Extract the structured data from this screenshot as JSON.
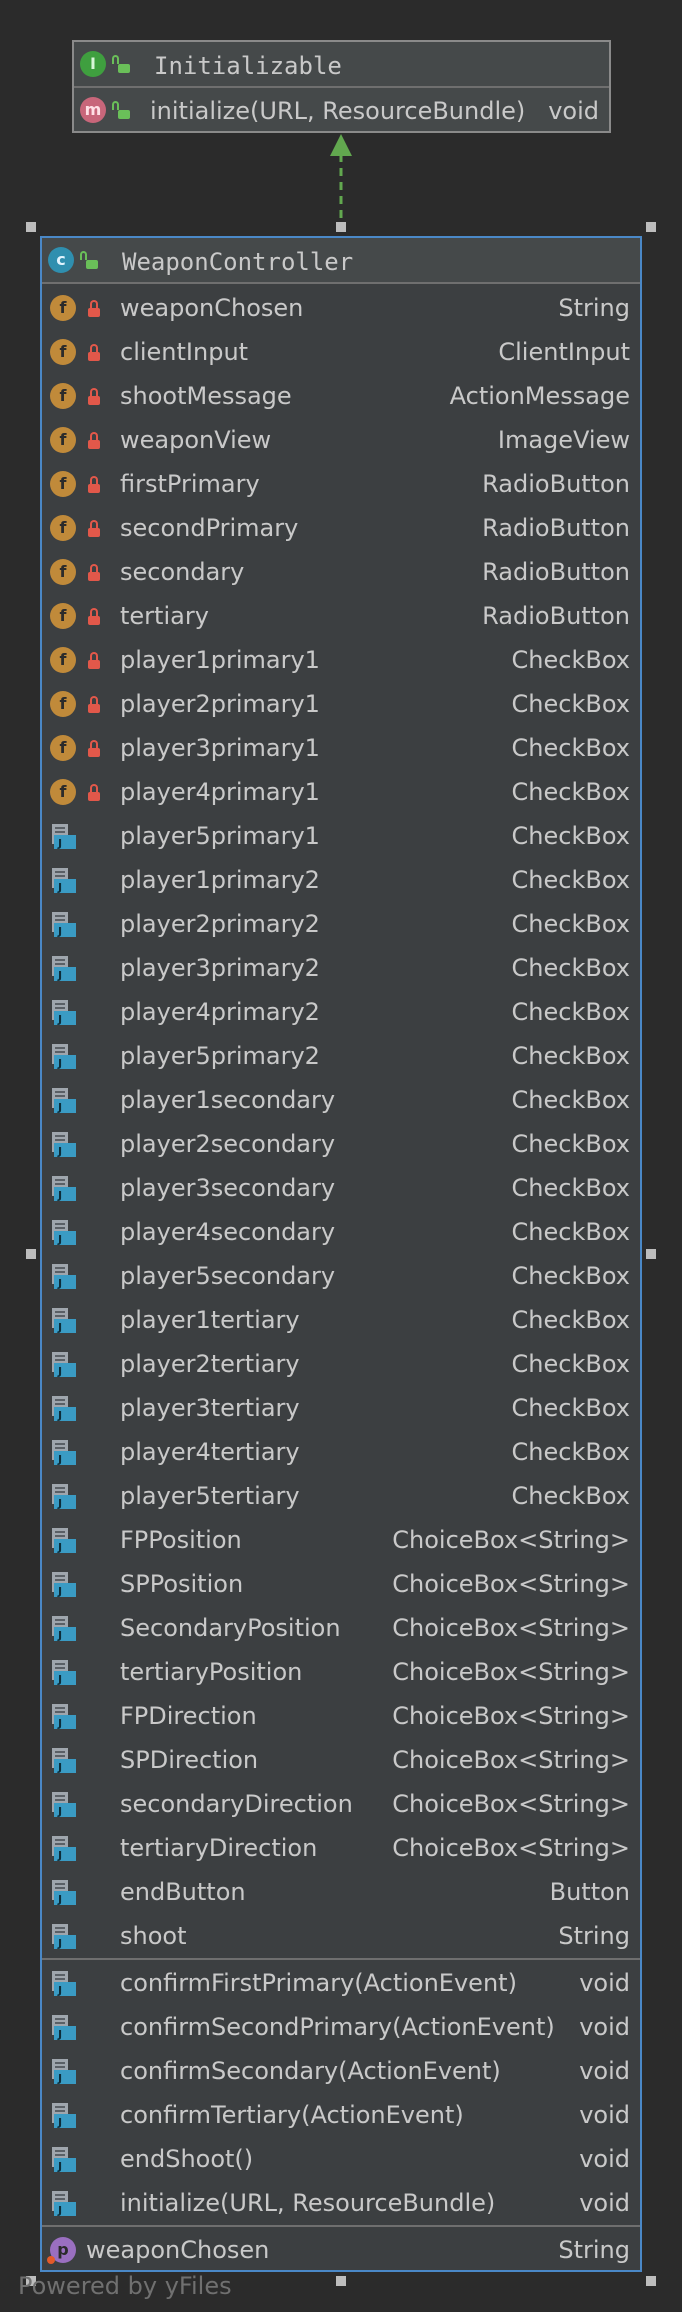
{
  "interface": {
    "name": "Initializable",
    "methods": [
      {
        "name": "initialize(URL, ResourceBundle)",
        "type": "void"
      }
    ]
  },
  "class": {
    "name": "WeaponController",
    "fields": [
      {
        "name": "weaponChosen",
        "type": "String",
        "icon": "field"
      },
      {
        "name": "clientInput",
        "type": "ClientInput",
        "icon": "field"
      },
      {
        "name": "shootMessage",
        "type": "ActionMessage",
        "icon": "field"
      },
      {
        "name": "weaponView",
        "type": "ImageView",
        "icon": "field"
      },
      {
        "name": "firstPrimary",
        "type": "RadioButton",
        "icon": "field"
      },
      {
        "name": "secondPrimary",
        "type": "RadioButton",
        "icon": "field"
      },
      {
        "name": "secondary",
        "type": "RadioButton",
        "icon": "field"
      },
      {
        "name": "tertiary",
        "type": "RadioButton",
        "icon": "field"
      },
      {
        "name": "player1primary1",
        "type": "CheckBox",
        "icon": "field"
      },
      {
        "name": "player2primary1",
        "type": "CheckBox",
        "icon": "field"
      },
      {
        "name": "player3primary1",
        "type": "CheckBox",
        "icon": "field"
      },
      {
        "name": "player4primary1",
        "type": "CheckBox",
        "icon": "field"
      },
      {
        "name": "player5primary1",
        "type": "CheckBox",
        "icon": "java"
      },
      {
        "name": "player1primary2",
        "type": "CheckBox",
        "icon": "java"
      },
      {
        "name": "player2primary2",
        "type": "CheckBox",
        "icon": "java"
      },
      {
        "name": "player3primary2",
        "type": "CheckBox",
        "icon": "java"
      },
      {
        "name": "player4primary2",
        "type": "CheckBox",
        "icon": "java"
      },
      {
        "name": "player5primary2",
        "type": "CheckBox",
        "icon": "java"
      },
      {
        "name": "player1secondary",
        "type": "CheckBox",
        "icon": "java"
      },
      {
        "name": "player2secondary",
        "type": "CheckBox",
        "icon": "java"
      },
      {
        "name": "player3secondary",
        "type": "CheckBox",
        "icon": "java"
      },
      {
        "name": "player4secondary",
        "type": "CheckBox",
        "icon": "java"
      },
      {
        "name": "player5secondary",
        "type": "CheckBox",
        "icon": "java"
      },
      {
        "name": "player1tertiary",
        "type": "CheckBox",
        "icon": "java"
      },
      {
        "name": "player2tertiary",
        "type": "CheckBox",
        "icon": "java"
      },
      {
        "name": "player3tertiary",
        "type": "CheckBox",
        "icon": "java"
      },
      {
        "name": "player4tertiary",
        "type": "CheckBox",
        "icon": "java"
      },
      {
        "name": "player5tertiary",
        "type": "CheckBox",
        "icon": "java"
      },
      {
        "name": "FPPosition",
        "type": "ChoiceBox<String>",
        "icon": "java"
      },
      {
        "name": "SPPosition",
        "type": "ChoiceBox<String>",
        "icon": "java"
      },
      {
        "name": "SecondaryPosition",
        "type": "ChoiceBox<String>",
        "icon": "java"
      },
      {
        "name": "tertiaryPosition",
        "type": "ChoiceBox<String>",
        "icon": "java"
      },
      {
        "name": "FPDirection",
        "type": "ChoiceBox<String>",
        "icon": "java"
      },
      {
        "name": "SPDirection",
        "type": "ChoiceBox<String>",
        "icon": "java"
      },
      {
        "name": "secondaryDirection",
        "type": "ChoiceBox<String>",
        "icon": "java"
      },
      {
        "name": "tertiaryDirection",
        "type": "ChoiceBox<String>",
        "icon": "java"
      },
      {
        "name": "endButton",
        "type": "Button",
        "icon": "java"
      },
      {
        "name": "shoot",
        "type": "String",
        "icon": "java"
      }
    ],
    "methods": [
      {
        "name": "confirmFirstPrimary(ActionEvent)",
        "type": "void"
      },
      {
        "name": "confirmSecondPrimary(ActionEvent)",
        "type": "void"
      },
      {
        "name": "confirmSecondary(ActionEvent)",
        "type": "void"
      },
      {
        "name": "confirmTertiary(ActionEvent)",
        "type": "void"
      },
      {
        "name": "endShoot()",
        "type": "void"
      },
      {
        "name": "initialize(URL, ResourceBundle)",
        "type": "void"
      }
    ],
    "properties": [
      {
        "name": "weaponChosen",
        "type": "String"
      }
    ]
  },
  "watermark": "Powered by yFiles",
  "colors": {
    "background": "#2b2b2b",
    "class_border": "#4a88c7",
    "arrow": "#62a84f"
  }
}
